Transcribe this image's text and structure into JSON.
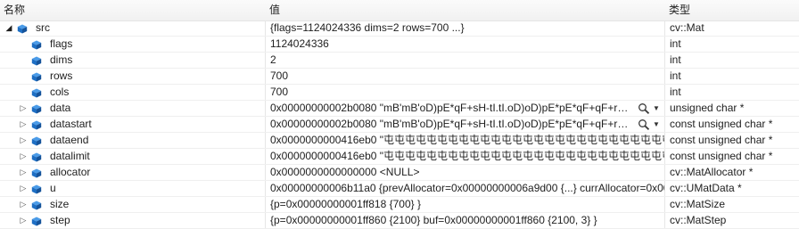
{
  "columns": {
    "name": "名称",
    "value": "值",
    "type": "类型"
  },
  "rows": [
    {
      "name": "src",
      "value": "{flags=1124024336 dims=2 rows=700 ...}",
      "type": "cv::Mat"
    },
    {
      "name": "flags",
      "value": "1124024336",
      "type": "int"
    },
    {
      "name": "dims",
      "value": "2",
      "type": "int"
    },
    {
      "name": "rows",
      "value": "700",
      "type": "int"
    },
    {
      "name": "cols",
      "value": "700",
      "type": "int"
    },
    {
      "name": "data",
      "value": "0x00000000002b0080 \"mB'mB'oD)pE*qF+sH-tI.tI.oD)oD)pE*pE*qF+qF+rG,pH,...",
      "type": "unsigned char *"
    },
    {
      "name": "datastart",
      "value": "0x00000000002b0080 \"mB'mB'oD)pE*qF+sH-tI.tI.oD)oD)pE*pE*qF+qF+rG,pH,...",
      "type": "const unsigned char *"
    },
    {
      "name": "dataend",
      "value": "0x0000000000416eb0 \"屯屯屯屯屯屯屯屯屯屯屯屯屯屯屯屯屯屯屯屯屯屯屯屯屯屯屯屯屯屯屯屯屯屯...",
      "type": "const unsigned char *"
    },
    {
      "name": "datalimit",
      "value": "0x0000000000416eb0 \"屯屯屯屯屯屯屯屯屯屯屯屯屯屯屯屯屯屯屯屯屯屯屯屯屯屯屯屯屯屯屯屯屯屯...",
      "type": "const unsigned char *"
    },
    {
      "name": "allocator",
      "value": "0x0000000000000000 <NULL>",
      "type": "cv::MatAllocator *"
    },
    {
      "name": "u",
      "value": "0x00000000006b11a0 {prevAllocator=0x00000000006a9d00 {...} currAllocator=0x000...",
      "type": "cv::UMatData *"
    },
    {
      "name": "size",
      "value": "{p=0x00000000001ff818 {700} }",
      "type": "cv::MatSize"
    },
    {
      "name": "step",
      "value": "{p=0x00000000001ff860 {2100} buf=0x00000000001ff860 {2100, 3} }",
      "type": "cv::MatStep"
    }
  ],
  "icons": {
    "field": "field-cube-icon",
    "magnifier": "magnifier-icon",
    "dropdown": "dropdown-arrow-icon"
  },
  "colors": {
    "field_icon": "#1e6fc4",
    "header_bg": "#f1f1f1",
    "grid": "#e6e6e6"
  }
}
